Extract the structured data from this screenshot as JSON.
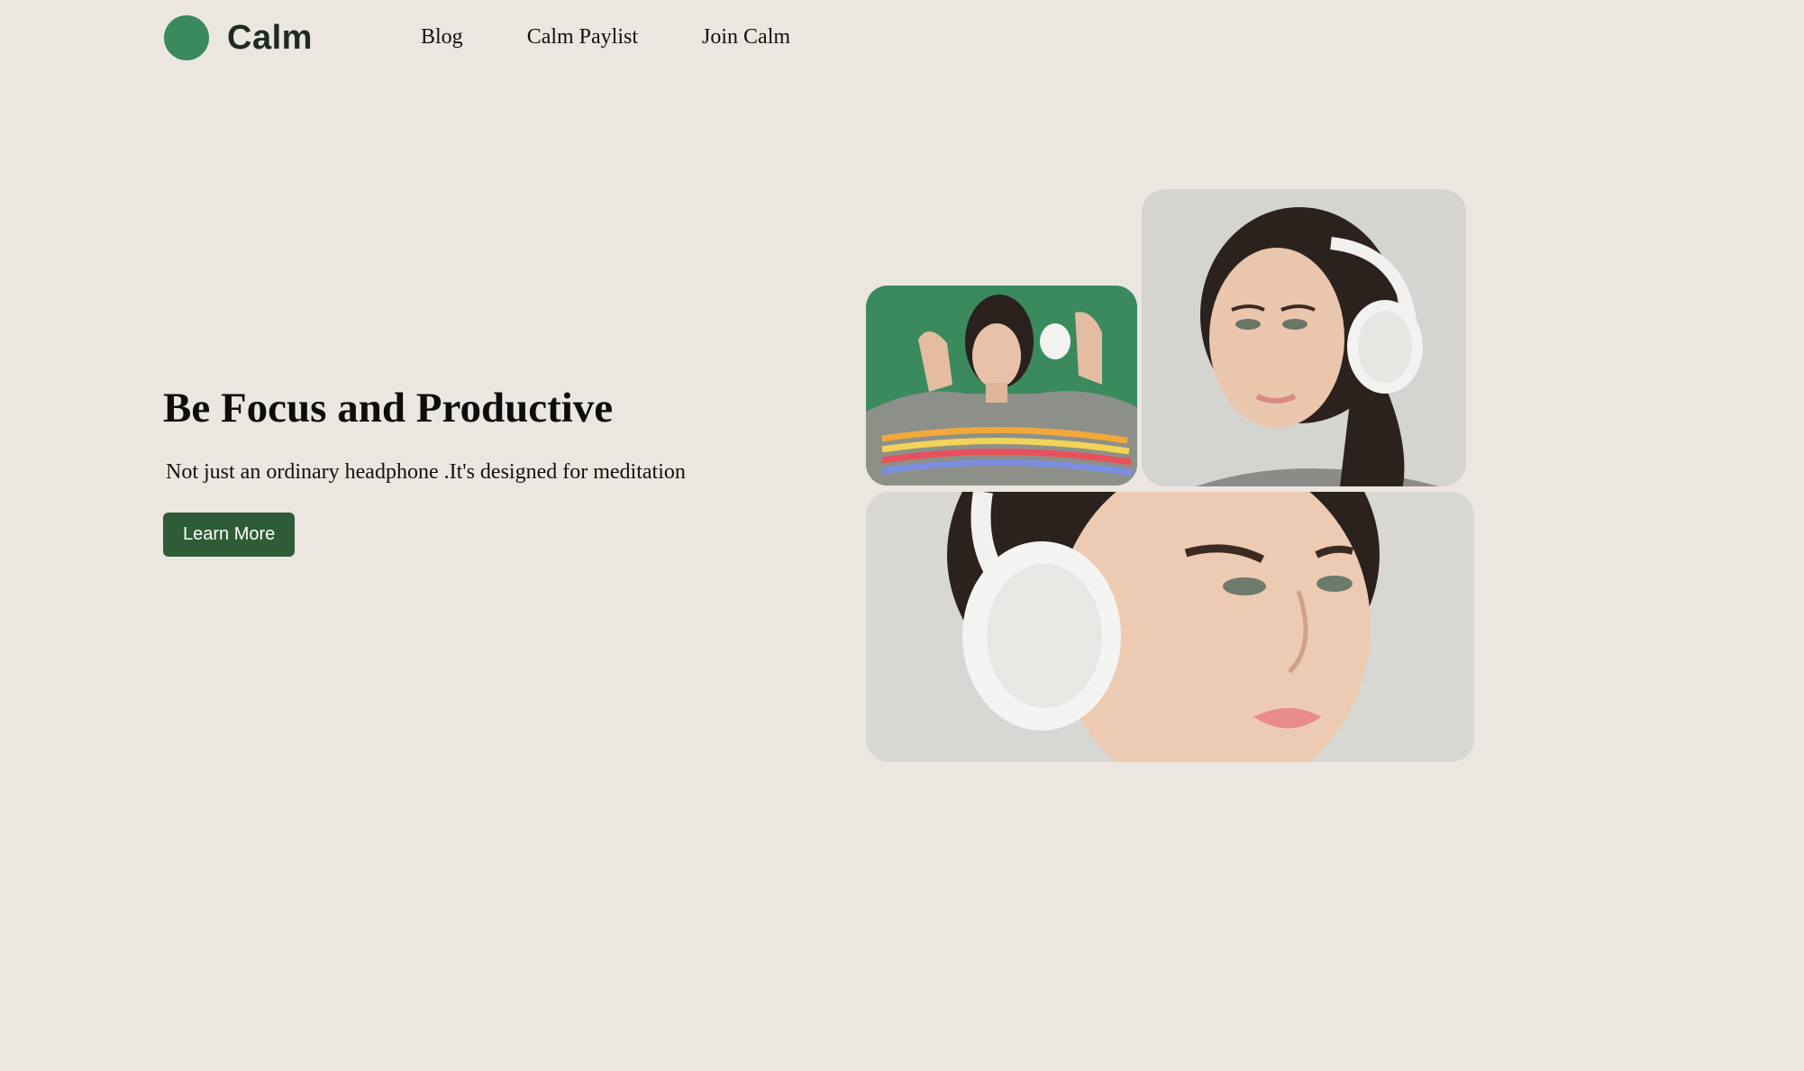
{
  "brand": {
    "name": "Calm",
    "logo_color": "#3a8a5d"
  },
  "nav": {
    "items": [
      "Blog",
      "Calm Paylist",
      "Join Calm"
    ]
  },
  "hero": {
    "title": "Be Focus and Productive",
    "subtitle": "Not just an ordinary headphone .It's designed for meditation",
    "cta_label": "Learn More",
    "cta_color": "#2e5c36"
  },
  "colors": {
    "background": "#ebe6e0",
    "accent_green": "#3a8a5d"
  }
}
